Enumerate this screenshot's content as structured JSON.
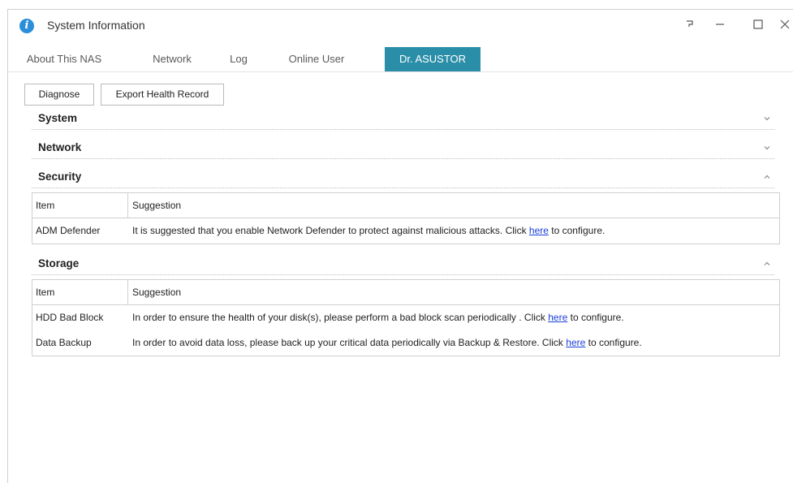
{
  "window": {
    "title": "System Information",
    "controls": [
      "help-icon",
      "minimize-icon",
      "maximize-icon",
      "close-icon"
    ]
  },
  "tabs": [
    {
      "label": "About This NAS",
      "active": false
    },
    {
      "label": "Network",
      "active": false
    },
    {
      "label": "Log",
      "active": false
    },
    {
      "label": "Online User",
      "active": false
    },
    {
      "label": "Dr. ASUSTOR",
      "active": true
    }
  ],
  "toolbar": {
    "diagnose_label": "Diagnose",
    "export_label": "Export Health Record"
  },
  "sections": {
    "system": {
      "title": "System",
      "expanded": false
    },
    "network": {
      "title": "Network",
      "expanded": false
    },
    "security": {
      "title": "Security",
      "expanded": true,
      "columns": [
        "Item",
        "Suggestion"
      ],
      "rows": [
        {
          "item": "ADM Defender",
          "before": "It is suggested that you enable Network Defender to protect against malicious attacks. Click ",
          "link": "here",
          "after": " to configure."
        }
      ]
    },
    "storage": {
      "title": "Storage",
      "expanded": true,
      "columns": [
        "Item",
        "Suggestion"
      ],
      "rows": [
        {
          "item": "HDD Bad Block",
          "before": "In order to ensure the health of your disk(s), please perform a bad block scan periodically . Click ",
          "link": "here",
          "after": " to configure."
        },
        {
          "item": "Data Backup",
          "before": "In order to avoid data loss, please back up your critical data periodically via Backup & Restore. Click ",
          "link": "here",
          "after": " to configure."
        }
      ]
    }
  },
  "colors": {
    "active_tab": "#2b8ea8",
    "link": "#1a3fd6",
    "app_icon": "#2a8fd8"
  }
}
